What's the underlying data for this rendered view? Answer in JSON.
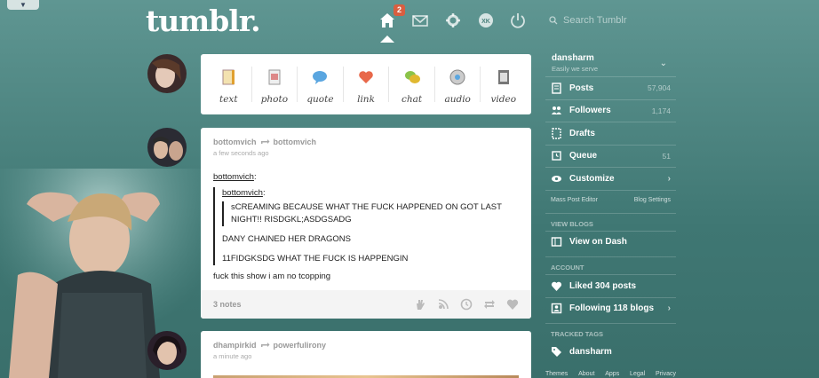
{
  "topbar": {
    "logo": "tumblr.",
    "notification_count": "2",
    "search_placeholder": "Search Tumblr"
  },
  "composer": {
    "types": [
      {
        "label": "text",
        "icon": "text-post-icon"
      },
      {
        "label": "photo",
        "icon": "photo-post-icon"
      },
      {
        "label": "quote",
        "icon": "quote-post-icon"
      },
      {
        "label": "link",
        "icon": "link-post-icon"
      },
      {
        "label": "chat",
        "icon": "chat-post-icon"
      },
      {
        "label": "audio",
        "icon": "audio-post-icon"
      },
      {
        "label": "video",
        "icon": "video-post-icon"
      }
    ]
  },
  "posts": [
    {
      "author": "bottomvich",
      "reblogged_from": "bottomvich",
      "time": "a few seconds ago",
      "reblog_chain_user_1": "bottomvich",
      "reblog_chain_user_2": "bottomvich",
      "text_1": "sCREAMING BECAUSE WHAT THE FUCK HAPPENED ON GOT LAST NIGHT!! RISDGKL;ASDGSADG",
      "text_2": "DANY CHAINED HER DRAGONS",
      "text_3": "11FIDGKSDG WHAT THE FUCK IS HAPPENGIN",
      "text_4": "fuck this show i am no tcopping",
      "notes": "3 notes"
    },
    {
      "author": "dhampirkid",
      "reblogged_from": "powerfulirony",
      "time": "a minute ago"
    }
  ],
  "sidebar": {
    "blog_name": "dansharm",
    "blog_subtitle": "Easily we serve",
    "items": [
      {
        "label": "Posts",
        "count": "57,904"
      },
      {
        "label": "Followers",
        "count": "1,174"
      },
      {
        "label": "Drafts",
        "count": ""
      },
      {
        "label": "Queue",
        "count": "51"
      },
      {
        "label": "Customize",
        "count": ""
      }
    ],
    "mass_post_editor": "Mass Post Editor",
    "blog_settings": "Blog Settings",
    "view_blogs_heading": "VIEW BLOGS",
    "view_on_dash": "View on Dash",
    "account_heading": "ACCOUNT",
    "liked_posts": "Liked 304 posts",
    "following_blogs": "Following 118 blogs",
    "tracked_tags_heading": "TRACKED TAGS",
    "tracked_tag": "dansharm"
  },
  "footer": [
    "Themes",
    "About",
    "Apps",
    "Legal",
    "Privacy"
  ],
  "colors": {
    "background": "#4a807c",
    "accent_badge": "#d95e40",
    "card": "#ffffff"
  }
}
